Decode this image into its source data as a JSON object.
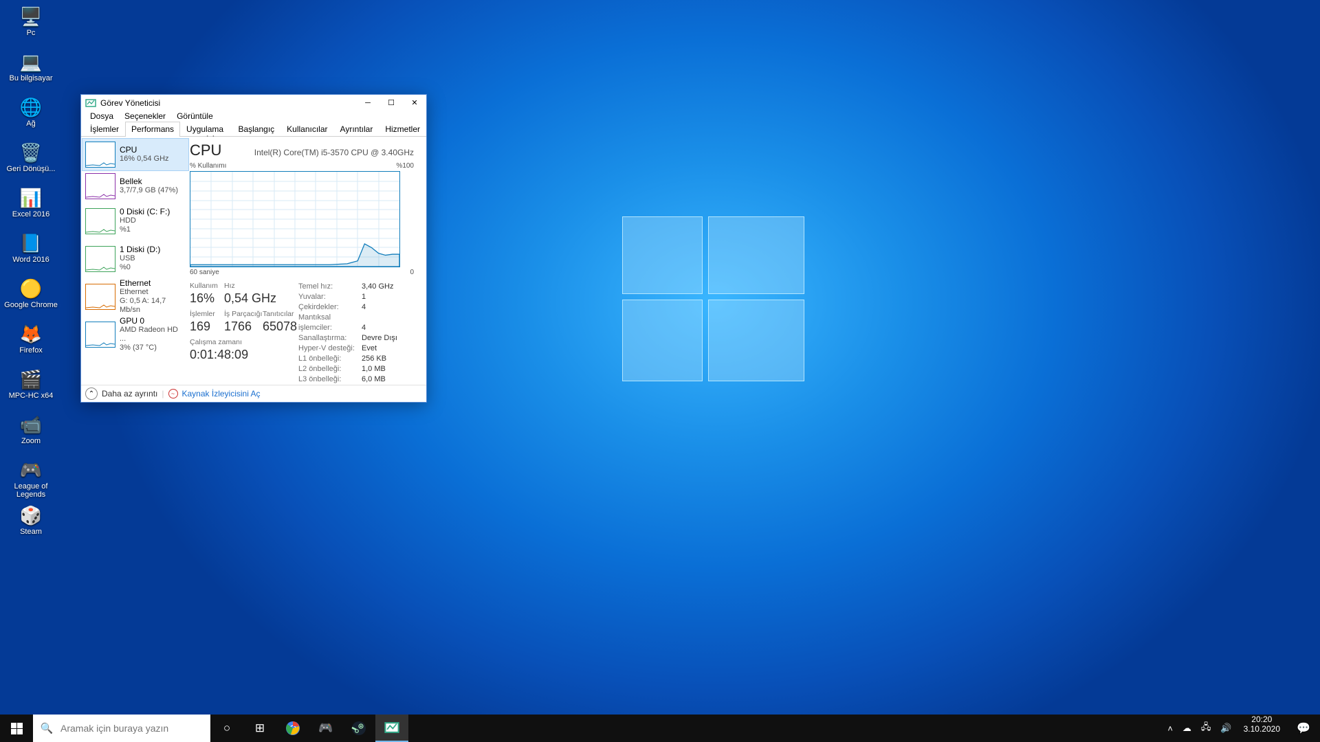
{
  "desktop": {
    "icons": [
      {
        "label": "Pc",
        "icon": "🖥️"
      },
      {
        "label": "Bu bilgisayar",
        "icon": "💻"
      },
      {
        "label": "Ağ",
        "icon": "🌐"
      },
      {
        "label": "Geri Dönüşü...",
        "icon": "🗑️"
      },
      {
        "label": "Excel 2016",
        "icon": "📊"
      },
      {
        "label": "Word 2016",
        "icon": "📘"
      },
      {
        "label": "Google Chrome",
        "icon": "🟡"
      },
      {
        "label": "Firefox",
        "icon": "🦊"
      },
      {
        "label": "MPC-HC x64",
        "icon": "🎬"
      },
      {
        "label": "Zoom",
        "icon": "📹"
      },
      {
        "label": "League of Legends",
        "icon": "🎮"
      },
      {
        "label": "Steam",
        "icon": "🎲"
      }
    ]
  },
  "taskmgr": {
    "title": "Görev Yöneticisi",
    "menu": [
      "Dosya",
      "Seçenekler",
      "Görüntüle"
    ],
    "tabs": [
      "İşlemler",
      "Performans",
      "Uygulama geçmişi",
      "Başlangıç",
      "Kullanıcılar",
      "Ayrıntılar",
      "Hizmetler"
    ],
    "active_tab": 1,
    "sidebar": [
      {
        "title": "CPU",
        "sub": "16% 0,54 GHz",
        "color": "#117dbb"
      },
      {
        "title": "Bellek",
        "sub": "3,7/7,9 GB (47%)",
        "color": "#8b2fa8"
      },
      {
        "title": "0 Diski (C: F:)",
        "sub": "HDD\n%1",
        "color": "#3da35a"
      },
      {
        "title": "1 Diski (D:)",
        "sub": "USB\n%0",
        "color": "#3da35a"
      },
      {
        "title": "Ethernet",
        "sub": "Ethernet\nG: 0,5 A: 14,7 Mb/sn",
        "color": "#d76b00"
      },
      {
        "title": "GPU 0",
        "sub": "AMD Radeon HD ...\n3% (37 °C)",
        "color": "#117dbb"
      }
    ],
    "detail": {
      "title": "CPU",
      "subtitle": "Intel(R) Core(TM) i5-3570 CPU @ 3.40GHz",
      "ylabel": "% Kullanımı",
      "ymax": "%100",
      "xlabel_l": "60 saniye",
      "xlabel_r": "0",
      "stats": {
        "kullanim_lbl": "Kullanım",
        "kullanim": "16%",
        "hiz_lbl": "Hız",
        "hiz": "0,54 GHz",
        "islemler_lbl": "İşlemler",
        "islemler": "169",
        "isparc_lbl": "İş Parçacığı",
        "isparc": "1766",
        "tanit_lbl": "Tanıtıcılar",
        "tanit": "65078",
        "uptime_lbl": "Çalışma zamanı",
        "uptime": "0:01:48:09"
      },
      "kv": [
        {
          "k": "Temel hız:",
          "v": "3,40 GHz"
        },
        {
          "k": "Yuvalar:",
          "v": "1"
        },
        {
          "k": "Çekirdekler:",
          "v": "4"
        },
        {
          "k": "Mantıksal işlemciler:",
          "v": "4"
        },
        {
          "k": "Sanallaştırma:",
          "v": "Devre Dışı"
        },
        {
          "k": "Hyper-V desteği:",
          "v": "Evet"
        },
        {
          "k": "L1 önbelleği:",
          "v": "256 KB"
        },
        {
          "k": "L2 önbelleği:",
          "v": "1,0 MB"
        },
        {
          "k": "L3 önbelleği:",
          "v": "6,0 MB"
        }
      ]
    },
    "footer": {
      "less": "Daha az ayrıntı",
      "resmon": "Kaynak İzleyicisini Aç"
    }
  },
  "taskbar": {
    "search_placeholder": "Aramak için buraya yazın",
    "clock_time": "20:20",
    "clock_date": "3.10.2020"
  },
  "chart_data": {
    "type": "line",
    "title": "CPU % Kullanımı",
    "xlabel": "saniye",
    "ylabel": "% Kullanımı",
    "xlim": [
      60,
      0
    ],
    "ylim": [
      0,
      100
    ],
    "x": [
      60,
      55,
      50,
      45,
      40,
      35,
      30,
      25,
      20,
      15,
      12,
      10,
      8,
      6,
      4,
      2,
      0
    ],
    "values": [
      2,
      2,
      2,
      2,
      2,
      2,
      2,
      2,
      2,
      3,
      6,
      24,
      20,
      14,
      12,
      13,
      13
    ]
  }
}
